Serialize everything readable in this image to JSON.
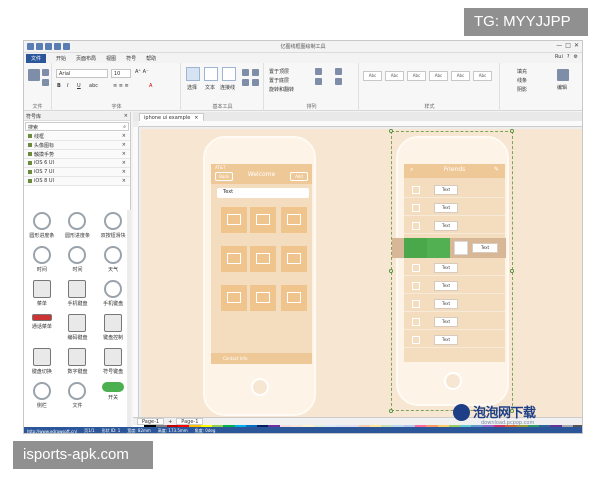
{
  "overlays": {
    "top_right": "TG: MYYJJPP",
    "bottom_left": "isports-apk.com"
  },
  "app": {
    "window_title": "亿图线框图绘制工具",
    "menus": [
      "文件",
      "开始",
      "页面布局",
      "视图",
      "符号",
      "帮助"
    ],
    "user": "Rui",
    "ribbon": {
      "file_label": "文件",
      "font_label": "字体",
      "font_name": "Arial",
      "font_size": "10",
      "basic_tools_label": "基本工具",
      "select_tool": "选择",
      "text_tool": "文本",
      "connector_tool": "连接线",
      "arrange_label": "排列",
      "style_label": "样式",
      "edit_label": "编辑",
      "arrange_items": [
        "置于顶层",
        "置于底层",
        "旋转和翻转"
      ],
      "style_box_label": "Abc",
      "right_items": [
        "填充",
        "线条",
        "阴影"
      ]
    },
    "sidebar": {
      "title": "符号库",
      "search_placeholder": "搜索",
      "libraries": [
        "线框",
        "头像图标",
        "触摸手势",
        "iOS 6 UI",
        "iOS 7 UI",
        "iOS 8 UI"
      ],
      "shapes": [
        {
          "label": "圆形进度条",
          "icon": "spinner-icon"
        },
        {
          "label": "圆形进度条",
          "icon": "progress-ring-icon"
        },
        {
          "label": "双按钮滑块",
          "icon": "slider-icon"
        },
        {
          "label": "时间",
          "icon": "time-icon"
        },
        {
          "label": "时间",
          "icon": "clock-icon"
        },
        {
          "label": "天气",
          "icon": "weather-icon"
        },
        {
          "label": "菜单",
          "icon": "menu-icon"
        },
        {
          "label": "手机键盘",
          "icon": "phone-keypad-icon"
        },
        {
          "label": "手机键盘",
          "icon": "dial-pad-icon"
        },
        {
          "label": "通话菜单",
          "icon": "call-menu-icon"
        },
        {
          "label": "编码键盘",
          "icon": "keypad-icon"
        },
        {
          "label": "键盘控制",
          "icon": "keyboard-control-icon"
        },
        {
          "label": "键盘切换",
          "icon": "keyboard-switch-icon"
        },
        {
          "label": "数字键盘",
          "icon": "number-pad-icon"
        },
        {
          "label": "符号键盘",
          "icon": "symbol-keyboard-icon"
        },
        {
          "label": "侧栏",
          "icon": "sidebar-icon"
        },
        {
          "label": "文件",
          "icon": "file-icon"
        },
        {
          "label": "开关",
          "icon": "toggle-icon"
        }
      ],
      "bottom_tabs": [
        "符号库",
        "文件恢复"
      ]
    },
    "document": {
      "tab_title": "iphone ui example",
      "phone_left": {
        "carrier": "AT&T",
        "top_left_btn": "Back",
        "top_title": "Welcome",
        "top_right_btn": "Add",
        "search_text": "Text",
        "bottom_text": "Contact Info"
      },
      "phone_right": {
        "top_title": "Friends",
        "rows": [
          "Text",
          "Text",
          "Text",
          "Text",
          "Text",
          "Text",
          "Text",
          "Text",
          "Text"
        ]
      }
    },
    "page_tabs": [
      "Page-1",
      "Page-1"
    ],
    "status": {
      "url": "http://www.edrawsoft.cn/",
      "items": [
        "页1/1",
        "形状 ID: 1",
        "宽度: 82mm",
        "高度: 173.5mm",
        "角度: 0deg"
      ]
    }
  },
  "logo": {
    "text": "泡泡网下载",
    "sub": "download.pcpop.com"
  },
  "palette": [
    "#ffffff",
    "#000000",
    "#7f7f7f",
    "#c00000",
    "#ff0000",
    "#ffc000",
    "#ffff00",
    "#92d050",
    "#00b050",
    "#00b0f0",
    "#0070c0",
    "#002060",
    "#7030a0",
    "#f2dcdb",
    "#fce4d6",
    "#fff2cc",
    "#e2efda",
    "#ddebf7",
    "#d9e1f2",
    "#e4dfec",
    "#f8cbad",
    "#ffe699",
    "#c6e0b4",
    "#bdd7ee",
    "#b4c6e7",
    "#ff6699",
    "#ff9966",
    "#ffcc66",
    "#99cc66",
    "#66cccc",
    "#6699cc",
    "#9966cc",
    "#cc3366",
    "#cc6633",
    "#999933",
    "#339966",
    "#336699",
    "#663399",
    "#aaaaaa",
    "#555555"
  ]
}
